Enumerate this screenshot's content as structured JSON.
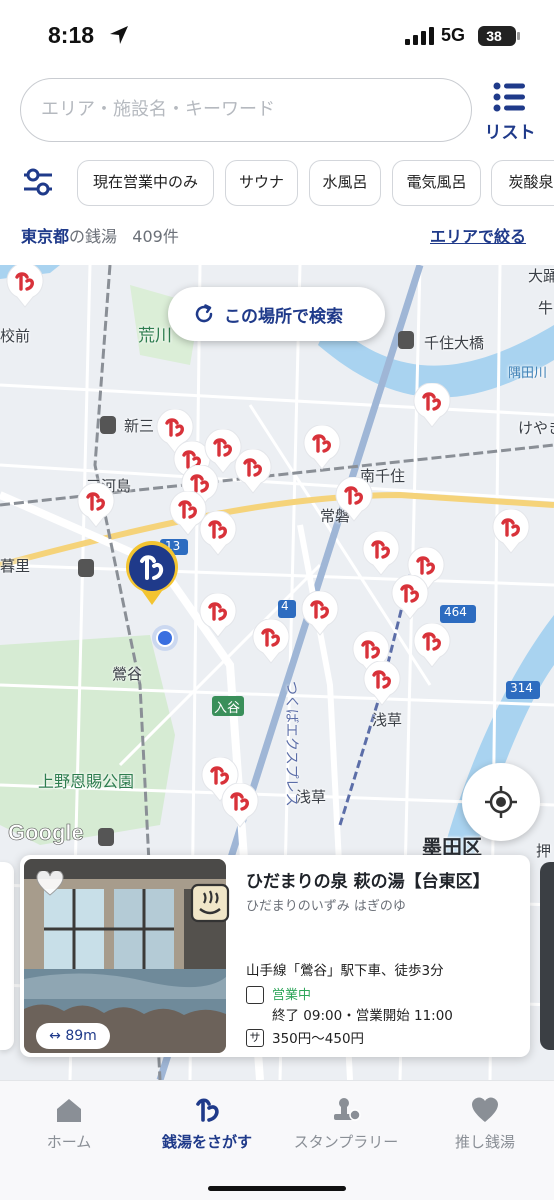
{
  "status_bar": {
    "time": "8:18",
    "network": "5G",
    "battery": "38"
  },
  "search": {
    "placeholder": "エリア・施設名・キーワード",
    "list_label": "リスト"
  },
  "filters": {
    "chips": [
      "現在営業中のみ",
      "サウナ",
      "水風呂",
      "電気風呂",
      "炭酸泉"
    ]
  },
  "results": {
    "area": "東京都",
    "suffix": "の銭湯",
    "count": "409件",
    "area_link": "エリアで絞る"
  },
  "map": {
    "search_here_label": "この場所で検索",
    "google_label": "Google",
    "labels": {
      "arakawa": "荒川",
      "kosen": "校前",
      "shinmikawa": "新三",
      "mikawajima": "三河島",
      "nippori": "暮里",
      "uguisudani": "鶯谷",
      "ueno_park": "上野恩賜公園",
      "minami_senju": "南千住",
      "kita_senju_ohashi": "千住大橋",
      "sumida_river": "隅田川",
      "keyaki": "けやき",
      "jobushi": "常磐",
      "asakusa": "浅草",
      "asakusa_station": "浅草",
      "sumida_ku": "墨田区",
      "iriya": "入谷",
      "express": "つくばエクスプレス",
      "odai": "大踊",
      "ushi": "牛",
      "oshi": "押",
      "route_4": "4",
      "route_464": "464",
      "route_314": "314",
      "route_13": "13"
    }
  },
  "card": {
    "title": "ひだまりの泉 萩の湯【台東区】",
    "kana": "ひだまりのいずみ はぎのゆ",
    "access": "山手線「鶯谷」駅下車、徒歩3分",
    "status": "営業中",
    "hours": "終了 09:00・営業開始 11:00",
    "price_icon": "サ",
    "price": "350円〜450円",
    "distance": "↔ 89m"
  },
  "tabs": [
    {
      "label": "ホーム",
      "icon": "home-icon"
    },
    {
      "label": "銭湯をさがす",
      "icon": "yu-icon"
    },
    {
      "label": "スタンプラリー",
      "icon": "stamp-icon"
    },
    {
      "label": "推し銭湯",
      "icon": "heart-icon"
    }
  ],
  "colors": {
    "brand_navy": "#1f3a8a",
    "pin_red": "#d8323a",
    "open_green": "#2ea65a"
  }
}
